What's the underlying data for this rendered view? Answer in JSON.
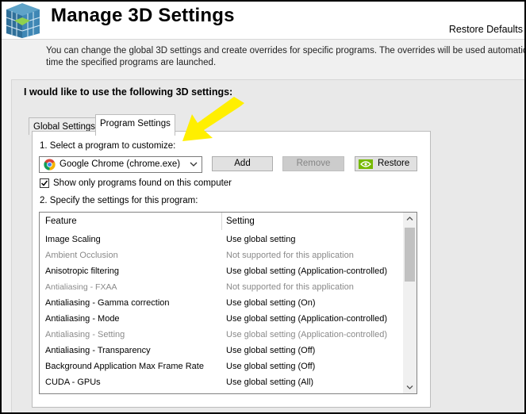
{
  "header": {
    "title": "Manage 3D Settings",
    "restore_defaults": "Restore Defaults",
    "description_line1": "You can change the global 3D settings and create overrides for specific programs. The overrides will be used automatically each",
    "description_line2": "time the specified programs are launched."
  },
  "main": {
    "section_title": "I would like to use the following 3D settings:",
    "tabs": [
      {
        "label": "Global Settings",
        "selected": false
      },
      {
        "label": "Program Settings",
        "selected": true
      }
    ],
    "select_label": "1. Select a program to customize:",
    "program_select": {
      "value": "Google Chrome (chrome.exe)"
    },
    "buttons": {
      "add": "Add",
      "remove": "Remove",
      "restore": "Restore"
    },
    "show_only": {
      "label": "Show only programs found on this computer",
      "checked": true
    },
    "specify_label": "2. Specify the settings for this program:",
    "list": {
      "columns": [
        "Feature",
        "Setting"
      ],
      "rows": [
        {
          "feature": "Image Scaling",
          "setting": "Use global setting",
          "disabled": false
        },
        {
          "feature": "Ambient Occlusion",
          "setting": "Not supported for this application",
          "disabled": true
        },
        {
          "feature": "Anisotropic filtering",
          "setting": "Use global setting (Application-controlled)",
          "disabled": false
        },
        {
          "feature": "Antialiasing - FXAA",
          "setting": "Not supported for this application",
          "disabled": true
        },
        {
          "feature": "Antialiasing - Gamma correction",
          "setting": "Use global setting (On)",
          "disabled": false
        },
        {
          "feature": "Antialiasing - Mode",
          "setting": "Use global setting (Application-controlled)",
          "disabled": false
        },
        {
          "feature": "Antialiasing - Setting",
          "setting": "Use global setting (Application-controlled)",
          "disabled": true
        },
        {
          "feature": "Antialiasing - Transparency",
          "setting": "Use global setting (Off)",
          "disabled": false
        },
        {
          "feature": "Background Application Max Frame Rate",
          "setting": "Use global setting (Off)",
          "disabled": false
        },
        {
          "feature": "CUDA - GPUs",
          "setting": "Use global setting (All)",
          "disabled": false
        }
      ]
    }
  },
  "colors": {
    "nvidia_green": "#76b900",
    "annotation_arrow": "#ffef00"
  }
}
